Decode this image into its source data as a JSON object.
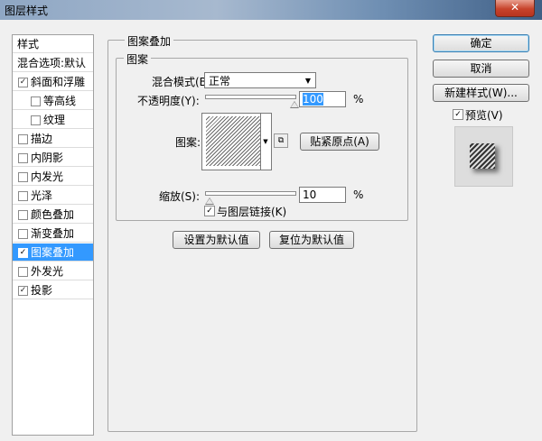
{
  "window": {
    "title": "图层样式",
    "close_label": "✕"
  },
  "left_list": {
    "header": "样式",
    "items": [
      {
        "label": "混合选项:默认",
        "checkbox": false,
        "checked": false,
        "selected": false,
        "sub": false
      },
      {
        "label": "斜面和浮雕",
        "checkbox": true,
        "checked": true,
        "selected": false,
        "sub": false
      },
      {
        "label": "等高线",
        "checkbox": true,
        "checked": false,
        "selected": false,
        "sub": true
      },
      {
        "label": "纹理",
        "checkbox": true,
        "checked": false,
        "selected": false,
        "sub": true
      },
      {
        "label": "描边",
        "checkbox": true,
        "checked": false,
        "selected": false,
        "sub": false
      },
      {
        "label": "内阴影",
        "checkbox": true,
        "checked": false,
        "selected": false,
        "sub": false
      },
      {
        "label": "内发光",
        "checkbox": true,
        "checked": false,
        "selected": false,
        "sub": false
      },
      {
        "label": "光泽",
        "checkbox": true,
        "checked": false,
        "selected": false,
        "sub": false
      },
      {
        "label": "颜色叠加",
        "checkbox": true,
        "checked": false,
        "selected": false,
        "sub": false
      },
      {
        "label": "渐变叠加",
        "checkbox": true,
        "checked": false,
        "selected": false,
        "sub": false
      },
      {
        "label": "图案叠加",
        "checkbox": true,
        "checked": true,
        "selected": true,
        "sub": false
      },
      {
        "label": "外发光",
        "checkbox": true,
        "checked": false,
        "selected": false,
        "sub": false
      },
      {
        "label": "投影",
        "checkbox": true,
        "checked": true,
        "selected": false,
        "sub": false
      }
    ]
  },
  "panel": {
    "group_title": "图案叠加",
    "inner_title": "图案",
    "blend_mode_label": "混合模式(B):",
    "blend_mode_value": "正常",
    "opacity_label": "不透明度(Y):",
    "opacity_value": "100",
    "opacity_fraction": 1.0,
    "percent": "%",
    "pattern_label": "图案:",
    "snap_origin_button": "贴紧原点(A)",
    "scale_label": "缩放(S):",
    "scale_value": "10",
    "scale_fraction": 0.0,
    "link_label": "与图层链接(K)",
    "link_checked": true,
    "make_default_button": "设置为默认值",
    "reset_default_button": "复位为默认值"
  },
  "right": {
    "ok_button": "确定",
    "cancel_button": "取消",
    "new_style_button": "新建样式(W)...",
    "preview_label": "预览(V)",
    "preview_checked": true
  },
  "icons": {
    "checkmark": "✓",
    "dropdown": "▼",
    "snap_icon": "⧉"
  },
  "colors": {
    "selection": "#3399ff",
    "dialog_bg": "#f0f0f0"
  }
}
